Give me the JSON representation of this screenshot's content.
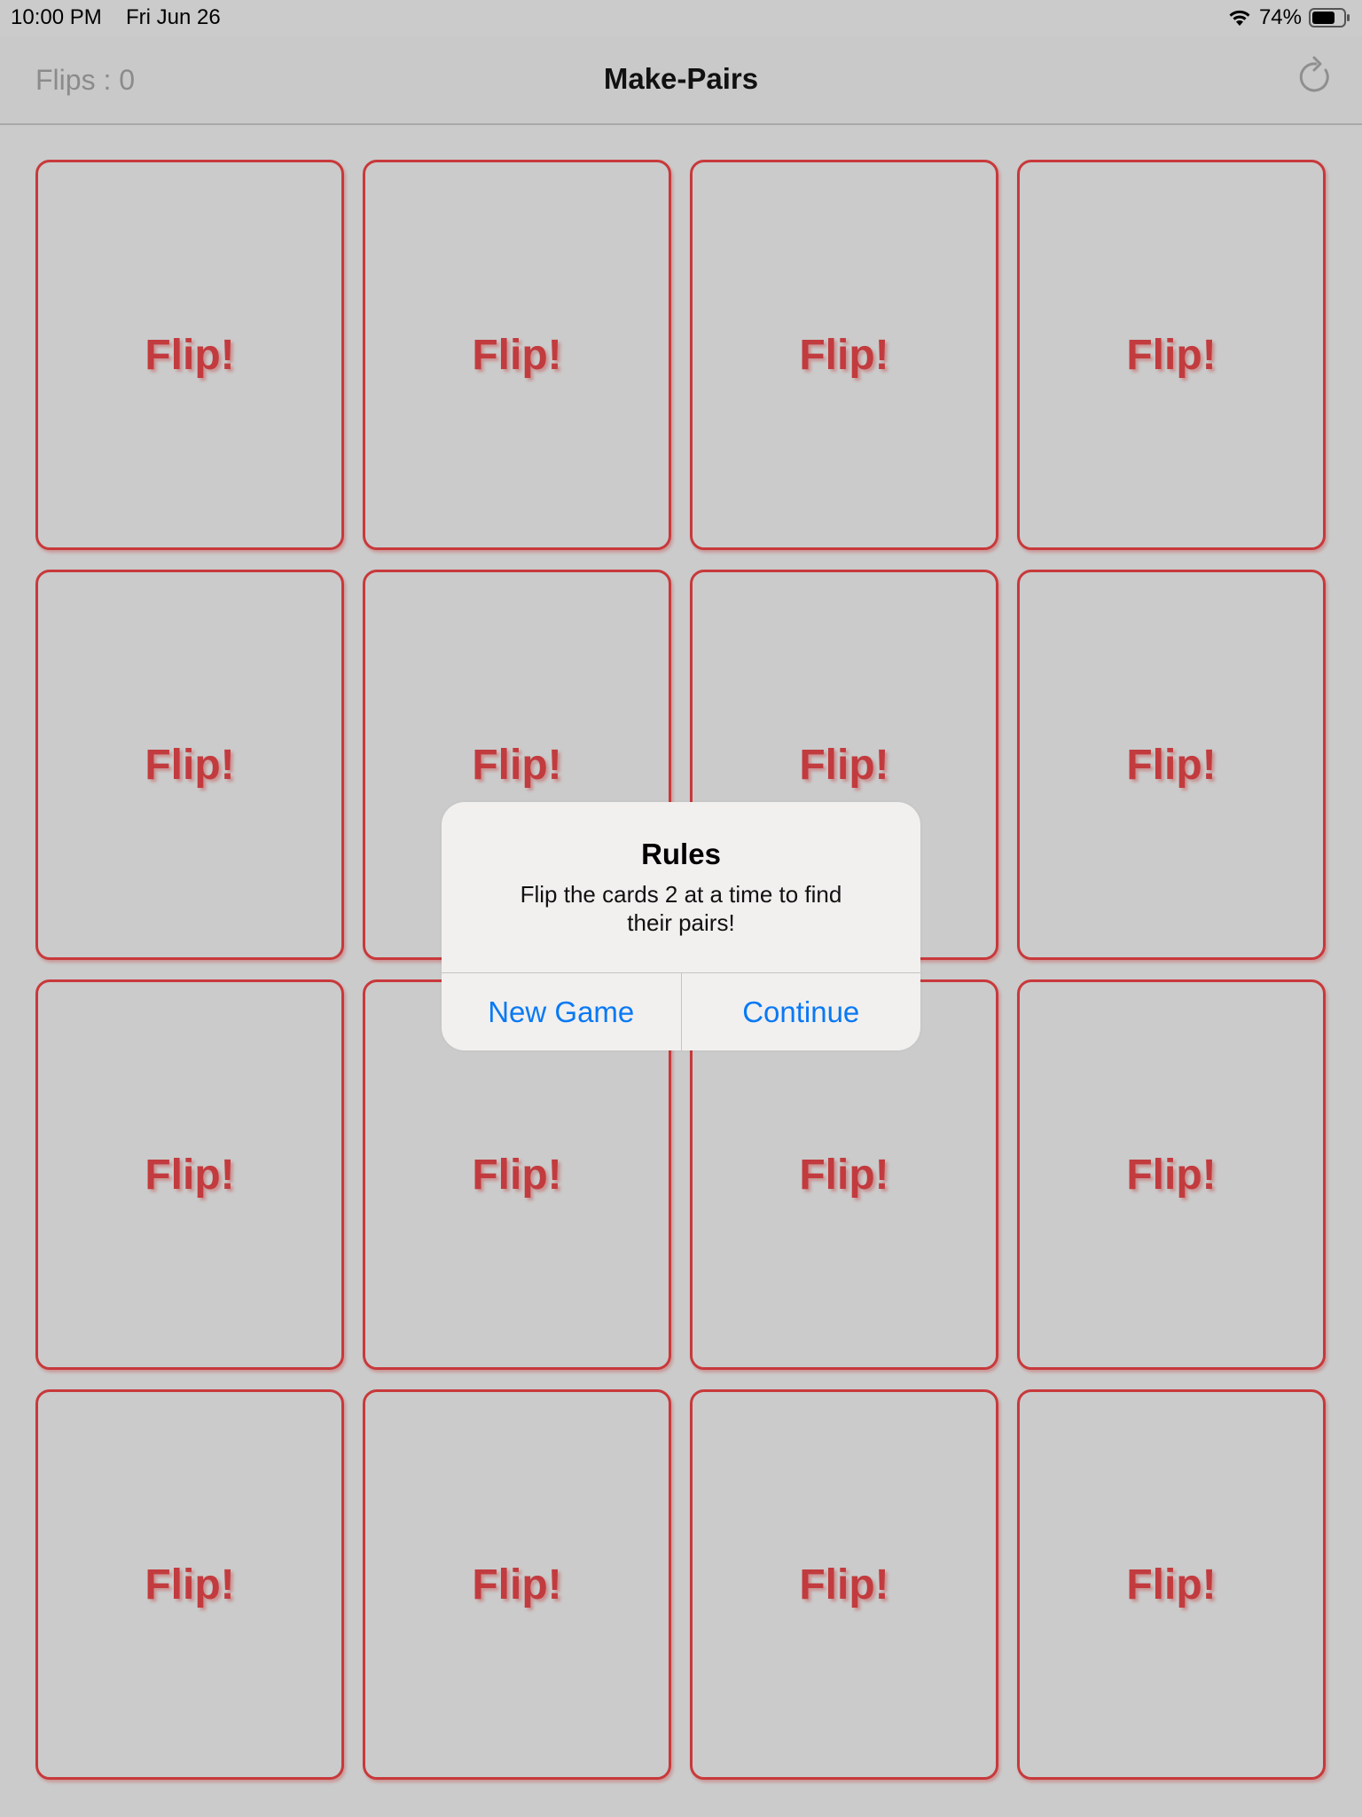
{
  "status_bar": {
    "time": "10:00 PM",
    "date": "Fri Jun 26",
    "battery_percent": "74%",
    "battery_level": 0.74
  },
  "nav": {
    "flips_label": "Flips : 0",
    "title": "Make-Pairs",
    "refresh_icon": "refresh-icon"
  },
  "cards": [
    {
      "label": "Flip!"
    },
    {
      "label": "Flip!"
    },
    {
      "label": "Flip!"
    },
    {
      "label": "Flip!"
    },
    {
      "label": "Flip!"
    },
    {
      "label": "Flip!"
    },
    {
      "label": "Flip!"
    },
    {
      "label": "Flip!"
    },
    {
      "label": "Flip!"
    },
    {
      "label": "Flip!"
    },
    {
      "label": "Flip!"
    },
    {
      "label": "Flip!"
    },
    {
      "label": "Flip!"
    },
    {
      "label": "Flip!"
    },
    {
      "label": "Flip!"
    },
    {
      "label": "Flip!"
    }
  ],
  "alert": {
    "title": "Rules",
    "message": "Flip the cards 2 at a time to find their pairs!",
    "buttons": {
      "new_game": "New Game",
      "continue": "Continue"
    }
  },
  "colors": {
    "background": "#cbcbcb",
    "card_border": "#c8393b",
    "card_text": "#c23b3e",
    "alert_button": "#0a79f3"
  }
}
